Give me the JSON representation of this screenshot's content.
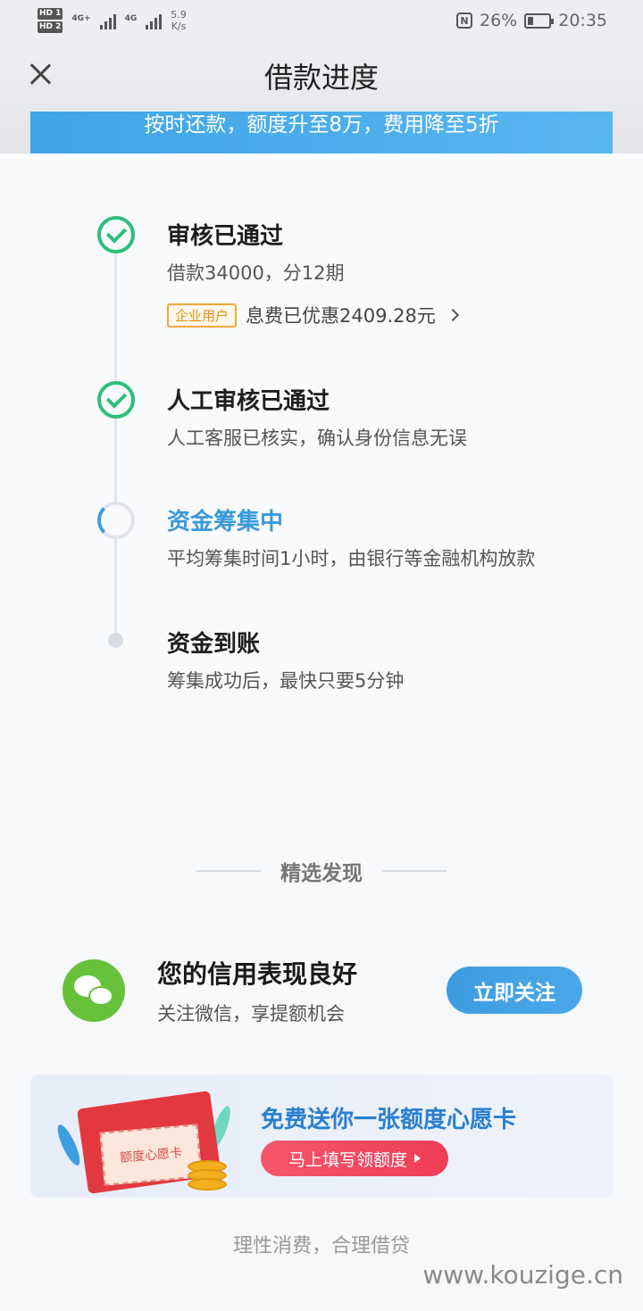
{
  "status_bar": {
    "hd1": "HD 1",
    "hd2": "HD 2",
    "net1": "4G+",
    "net2": "4G",
    "speed_value": "5.9",
    "speed_unit": "K/s",
    "battery": "26%",
    "time": "20:35",
    "battery_level": 0.26
  },
  "header": {
    "title": "借款进度",
    "banner": "按时还款，额度升至8万，费用降至5折"
  },
  "steps": [
    {
      "title": "审核已通过",
      "desc": "借款34000，分12期",
      "status": "done"
    },
    {
      "title": "人工审核已通过",
      "desc": "人工客服已核实，确认身份信息无误",
      "status": "done"
    },
    {
      "title": "资金筹集中",
      "desc": "平均筹集时间1小时，由银行等金融机构放款",
      "status": "in-progress"
    },
    {
      "title": "资金到账",
      "desc": "筹集成功后，最快只要5分钟",
      "status": "pending"
    }
  ],
  "promo": {
    "tag": "企业用户",
    "text": "息费已优惠2409.28元"
  },
  "discover": {
    "label": "精选发现"
  },
  "wechat": {
    "title": "您的信用表现良好",
    "subtitle": "关注微信，享提额机会",
    "button": "立即关注"
  },
  "card": {
    "title": "免费送你一张额度心愿卡",
    "button": "马上填写领额度",
    "illus_text": "额度心愿卡"
  },
  "footer": {
    "text": "理性消费，合理借贷"
  },
  "watermark": "www.kouzige.cn",
  "colors": {
    "success": "#2dbf7a",
    "accent": "#3a9ad9",
    "tag_orange": "#e59018",
    "cta_red": "#ee3d56"
  }
}
